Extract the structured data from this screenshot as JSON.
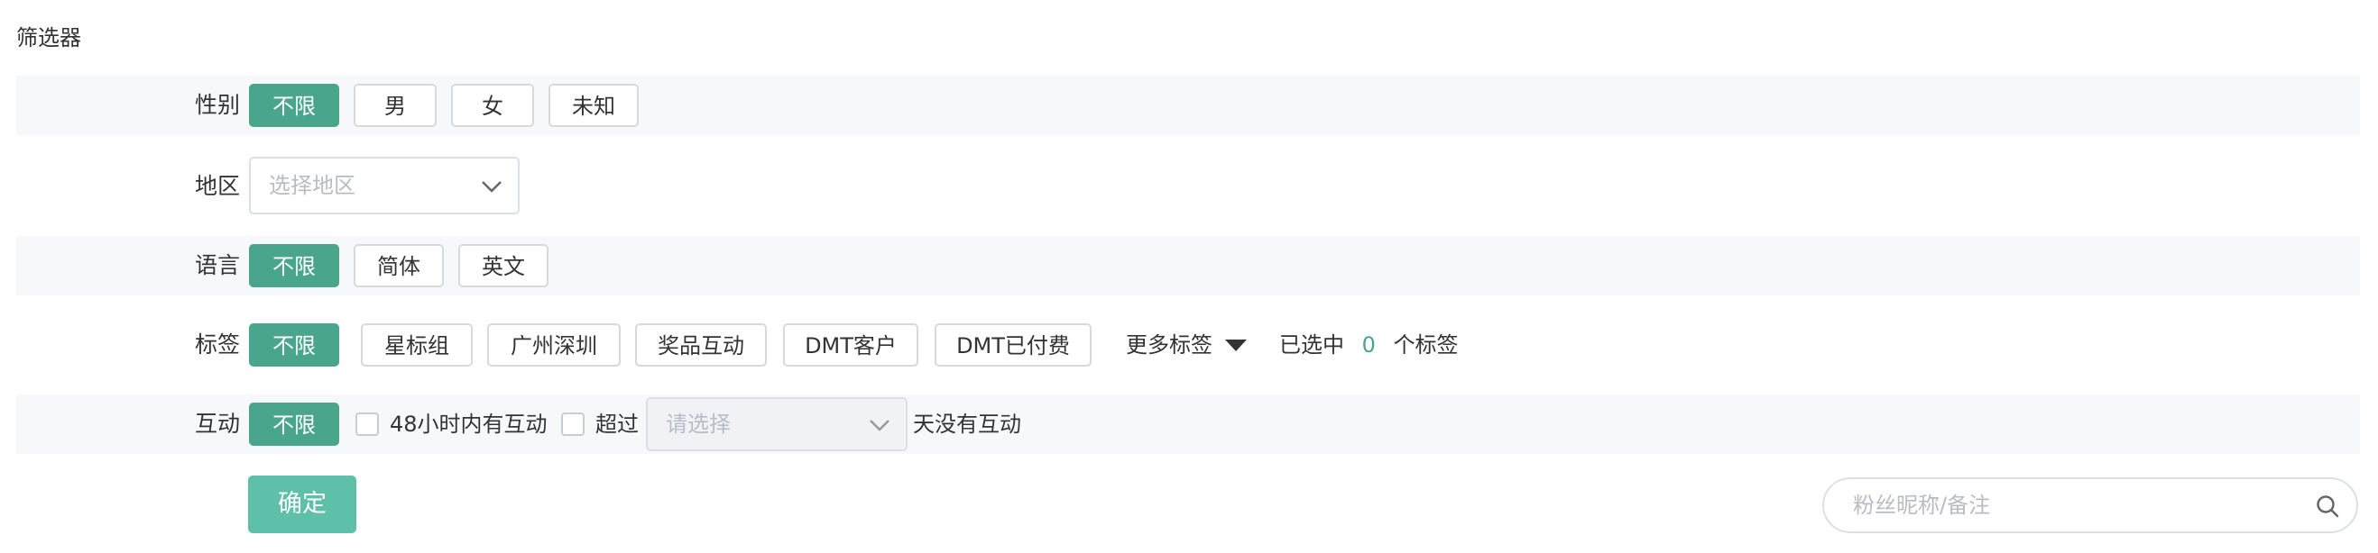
{
  "filter": {
    "title": "筛选器",
    "gender": {
      "label": "性别",
      "options": [
        "不限",
        "男",
        "女",
        "未知"
      ]
    },
    "region": {
      "label": "地区",
      "placeholder": "选择地区"
    },
    "language": {
      "label": "语言",
      "options": [
        "不限",
        "简体",
        "英文"
      ]
    },
    "tags": {
      "label": "标签",
      "options": [
        "不限",
        "星标组",
        "广州深圳",
        "奖品互动",
        "DMT客户",
        "DMT已付费"
      ],
      "more_label": "更多标签",
      "selected_prefix": "已选中",
      "selected_count": "0",
      "selected_suffix": "个标签"
    },
    "interaction": {
      "label": "互动",
      "unlimited": "不限",
      "within_48h": "48小时内有互动",
      "over_label": "超过",
      "days_placeholder": "请选择",
      "no_interaction_suffix": "天没有互动"
    },
    "confirm_label": "确定",
    "search_placeholder": "粉丝昵称/备注"
  },
  "colors": {
    "accent": "#4aa58d",
    "confirm_bg": "#5ec0a8",
    "row_shade": "#f7f8fa",
    "border": "#d9d9d9",
    "placeholder": "#b8bcc4"
  }
}
